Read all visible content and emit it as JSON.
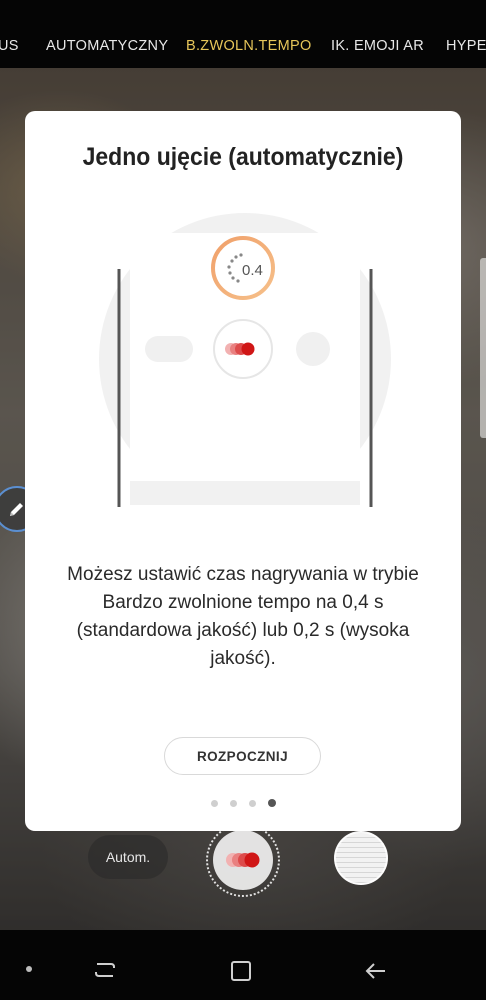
{
  "mode_bar": {
    "items": [
      "US",
      "AUTOMATYCZNY",
      "B.ZWOLN.TEMPO",
      "IK. EMOJI AR",
      "HYPE"
    ],
    "active_index": 2
  },
  "dialog": {
    "title": "Jedno ujęcie (automatycznie)",
    "illustration": {
      "timer_value": "0.4"
    },
    "body": "Możesz ustawić czas nagrywania w trybie Bardzo zwolnione tempo na 0,4 s (standardowa jakość) lub 0,2 s (wysoka jakość).",
    "start_button": "ROZPOCZNIJ",
    "pages": {
      "total": 4,
      "current": 4
    }
  },
  "camera_controls": {
    "mode_button": "Autom."
  },
  "colors": {
    "active_mode": "#e7c65a",
    "pen_ring": "#5b8fd1",
    "record_red": "#d01616"
  },
  "icons": [
    "pen-icon",
    "super-slow-mo-icon",
    "recent-apps-icon",
    "home-icon",
    "back-icon"
  ]
}
